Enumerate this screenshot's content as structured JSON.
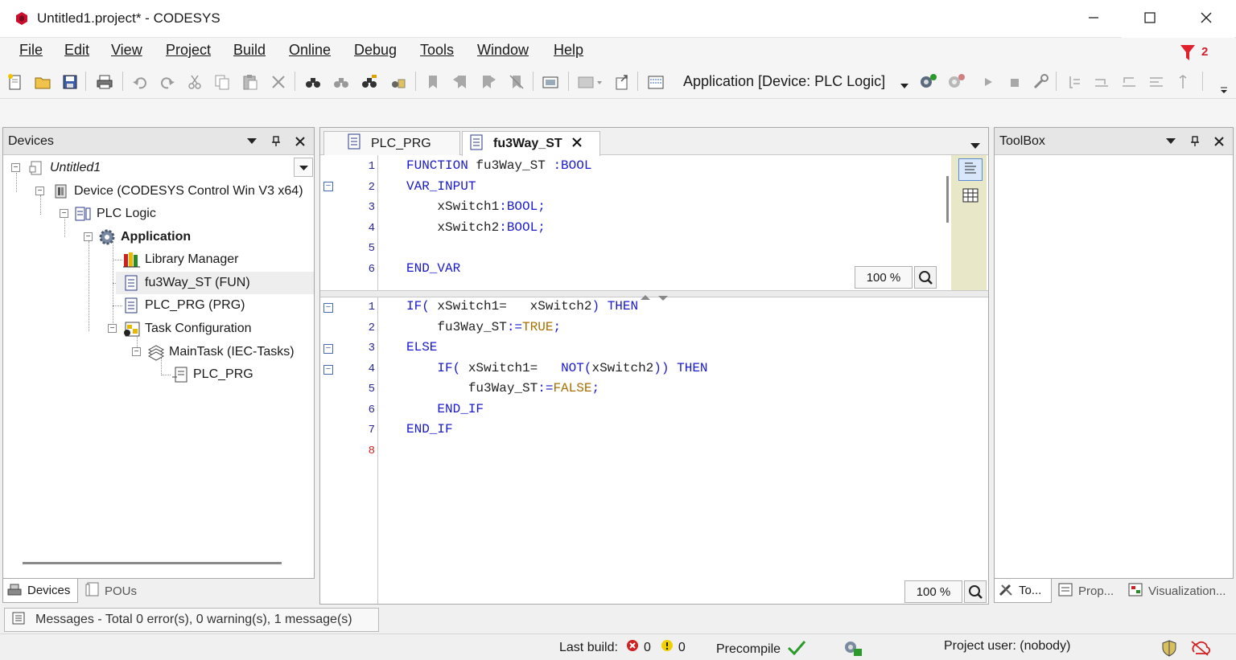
{
  "window": {
    "title": "Untitled1.project* - CODESYS",
    "app_icon": "codesys-logo-icon",
    "controls": [
      "minimize-icon",
      "maximize-icon",
      "close-icon"
    ]
  },
  "menu": {
    "items": [
      "File",
      "Edit",
      "View",
      "Project",
      "Build",
      "Online",
      "Debug",
      "Tools",
      "Window",
      "Help"
    ],
    "filter_count": "2"
  },
  "toolbar": {
    "application_combo": "Application [Device: PLC Logic]"
  },
  "devices_panel": {
    "title": "Devices",
    "tree": [
      {
        "label": "Untitled1",
        "icon": "project-icon"
      },
      {
        "label": "Device (CODESYS Control Win V3 x64)",
        "icon": "device-icon"
      },
      {
        "label": "PLC Logic",
        "icon": "plc-logic-icon"
      },
      {
        "label": "Application",
        "icon": "application-gear-icon"
      },
      {
        "label": "Library Manager",
        "icon": "library-icon"
      },
      {
        "label": "fu3Way_ST (FUN)",
        "icon": "pou-icon"
      },
      {
        "label": "PLC_PRG (PRG)",
        "icon": "pou-icon"
      },
      {
        "label": "Task Configuration",
        "icon": "task-config-icon"
      },
      {
        "label": "MainTask (IEC-Tasks)",
        "icon": "task-icon"
      },
      {
        "label": "PLC_PRG",
        "icon": "program-call-icon"
      }
    ],
    "bottom_tabs": [
      "Devices",
      "POUs"
    ]
  },
  "editor": {
    "tabs": [
      "PLC_PRG",
      "fu3Way_ST"
    ],
    "active_tab": "fu3Way_ST",
    "decl_zoom": "100 %",
    "impl_zoom": "100 %",
    "declaration_lines": [
      {
        "n": "1",
        "parts": [
          [
            "kw",
            "FUNCTION"
          ],
          [
            "",
            "fu3Way_ST"
          ],
          [
            "kw",
            ":"
          ],
          [
            "kw",
            "BOOL"
          ]
        ]
      },
      {
        "n": "2",
        "parts": [
          [
            "kw",
            "VAR_INPUT"
          ]
        ]
      },
      {
        "n": "3",
        "parts": [
          [
            "",
            "    xSwitch1"
          ],
          [
            "kw",
            ":BOOL;"
          ]
        ]
      },
      {
        "n": "4",
        "parts": [
          [
            "",
            "    xSwitch2"
          ],
          [
            "kw",
            ":BOOL;"
          ]
        ]
      },
      {
        "n": "5",
        "parts": []
      },
      {
        "n": "6",
        "parts": [
          [
            "kw",
            "END_VAR"
          ]
        ]
      }
    ],
    "implementation_lines": [
      {
        "n": "1",
        "text": "IF( xSwitch1=   xSwitch2) THEN"
      },
      {
        "n": "2",
        "text": "    fu3Way_ST:=TRUE;"
      },
      {
        "n": "3",
        "text": "ELSE"
      },
      {
        "n": "4",
        "text": "    IF( xSwitch1=   NOT(xSwitch2)) THEN"
      },
      {
        "n": "5",
        "text": "        fu3Way_ST:=FALSE;"
      },
      {
        "n": "6",
        "text": "    END_IF"
      },
      {
        "n": "7",
        "text": "END_IF"
      },
      {
        "n": "8",
        "text": ""
      }
    ]
  },
  "toolbox_panel": {
    "title": "ToolBox",
    "bottom_tabs": [
      "To...",
      "Prop...",
      "Visualization..."
    ]
  },
  "messages": {
    "label": "Messages - Total 0 error(s), 0 warning(s), 1 message(s)"
  },
  "status": {
    "last_build_label": "Last build:",
    "errors": "0",
    "warnings": "0",
    "precompile": "Precompile",
    "project_user": "Project user: (nobody)"
  },
  "colors": {
    "keyword": "#1a1ad0",
    "literal": "#a87000",
    "line_number": "#2a2a9a",
    "accent_red": "#d0202a"
  }
}
